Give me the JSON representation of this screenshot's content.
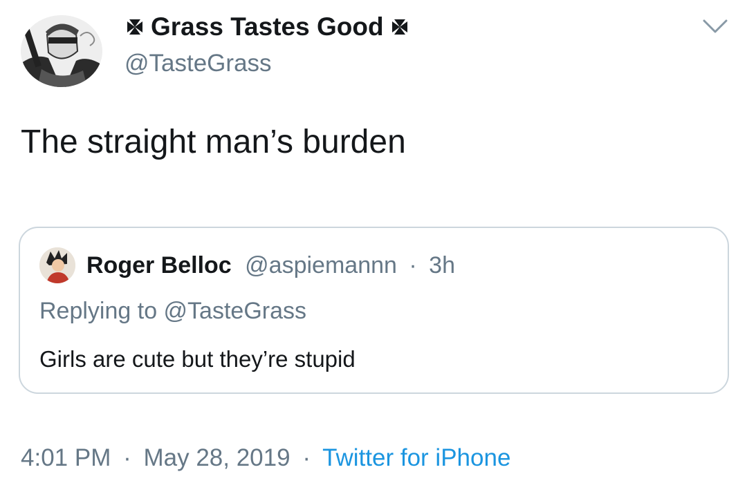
{
  "author": {
    "display_name": "Grass Tastes Good",
    "name_prefix_icon": "maltese-cross-icon",
    "name_suffix_icon": "maltese-cross-icon",
    "handle": "@TasteGrass",
    "avatar_icon": "profile-avatar"
  },
  "menu": {
    "icon": "chevron-down-icon"
  },
  "tweet": {
    "text": "The straight man’s burden"
  },
  "quoted_tweet": {
    "display_name": "Roger Belloc",
    "handle": "@aspiemannn",
    "separator": "·",
    "time_ago": "3h",
    "replying_to": "Replying to @TasteGrass",
    "text": "Girls are cute but they’re stupid"
  },
  "footer": {
    "time": "4:01 PM",
    "separator": "·",
    "date": "May 28, 2019",
    "source": "Twitter for iPhone"
  },
  "colors": {
    "text": "#14171a",
    "secondary": "#657786",
    "link": "#1b95e0",
    "border": "#ccd6dd"
  }
}
